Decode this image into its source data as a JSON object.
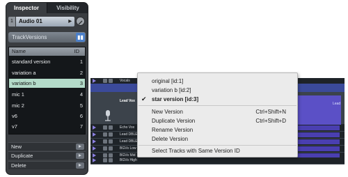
{
  "inspector": {
    "tabs": [
      "Inspector",
      "Visibility"
    ],
    "track": {
      "number": "1",
      "name": "Audio 01"
    },
    "section": "TrackVersions",
    "columns": {
      "name": "Name",
      "id": "ID"
    },
    "versions": [
      {
        "name": "standard version",
        "id": "1"
      },
      {
        "name": "variation a",
        "id": "2"
      },
      {
        "name": "variation b",
        "id": "3"
      },
      {
        "name": "mic 1",
        "id": "4"
      },
      {
        "name": "mic 2",
        "id": "5"
      },
      {
        "name": "v6",
        "id": "6"
      },
      {
        "name": "v7",
        "id": "7"
      }
    ],
    "actions": [
      "New",
      "Duplicate",
      "Delete"
    ]
  },
  "tracks": {
    "lane_labels": [
      "Vocals",
      "Lead Vox",
      "Echo Vox",
      "Lead DBLE L",
      "Lead DBLE R",
      "BGVs Low",
      "BGVs Mid",
      "BGVs High"
    ],
    "event_label": "Lead"
  },
  "menu": {
    "versions": [
      {
        "label": "original [id:1]",
        "checked": false
      },
      {
        "label": "variation b [id:2]",
        "checked": false
      },
      {
        "label": "star version [id:3]",
        "checked": true
      }
    ],
    "commands": [
      {
        "label": "New Version",
        "shortcut": "Ctrl+Shift+N"
      },
      {
        "label": "Duplicate Version",
        "shortcut": "Ctrl+Shift+D"
      },
      {
        "label": "Rename Version",
        "shortcut": ""
      },
      {
        "label": "Delete Version",
        "shortcut": ""
      }
    ],
    "footer": "Select Tracks with Same Version ID"
  },
  "colors": {
    "selected_row": "#b4dbc9",
    "version_icon": "#4b7fc9",
    "events": "#4a3fb0"
  }
}
